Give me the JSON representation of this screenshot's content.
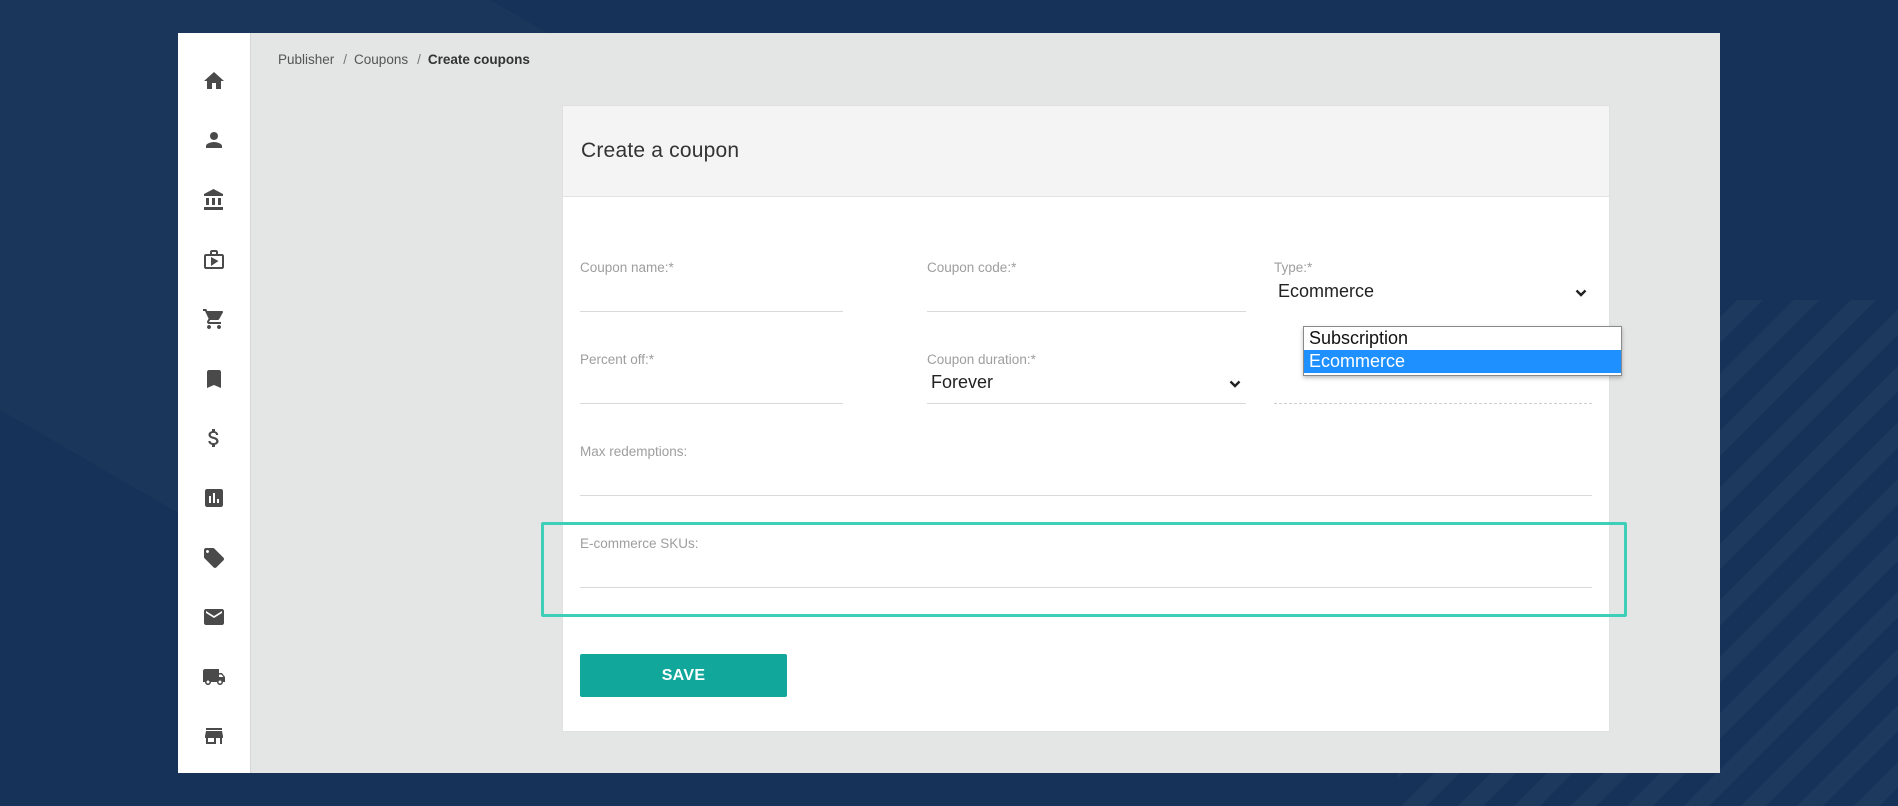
{
  "breadcrumb": {
    "items": [
      "Publisher",
      "Coupons"
    ],
    "separator": "/",
    "current": "Create coupons"
  },
  "sidebar": {
    "items": [
      {
        "icon": "home-icon"
      },
      {
        "icon": "person-icon"
      },
      {
        "icon": "bank-icon"
      },
      {
        "icon": "media-case-icon"
      },
      {
        "icon": "cart-icon"
      },
      {
        "icon": "bookmark-icon"
      },
      {
        "icon": "dollar-icon"
      },
      {
        "icon": "bar-chart-icon"
      },
      {
        "icon": "ticket-icon"
      },
      {
        "icon": "mail-icon"
      },
      {
        "icon": "truck-icon"
      },
      {
        "icon": "store-icon"
      }
    ]
  },
  "form": {
    "title": "Create a coupon",
    "coupon_name_label": "Coupon name:*",
    "coupon_name_value": "",
    "coupon_code_label": "Coupon code:*",
    "coupon_code_value": "",
    "type_label": "Type:*",
    "type_value": "Ecommerce",
    "type_options": [
      "Subscription",
      "Ecommerce"
    ],
    "percent_off_label": "Percent off:*",
    "percent_off_value": "",
    "coupon_duration_label": "Coupon duration:*",
    "coupon_duration_value": "Forever",
    "max_redemptions_label": "Max redemptions:",
    "max_redemptions_value": "",
    "ecommerce_skus_label": "E-commerce SKUs:",
    "ecommerce_skus_value": "",
    "save_label": "SAVE"
  },
  "colors": {
    "background": "#163258",
    "accent": "#11a89b",
    "highlight": "#3ecfb8",
    "selected_option": "#1e90ff"
  }
}
